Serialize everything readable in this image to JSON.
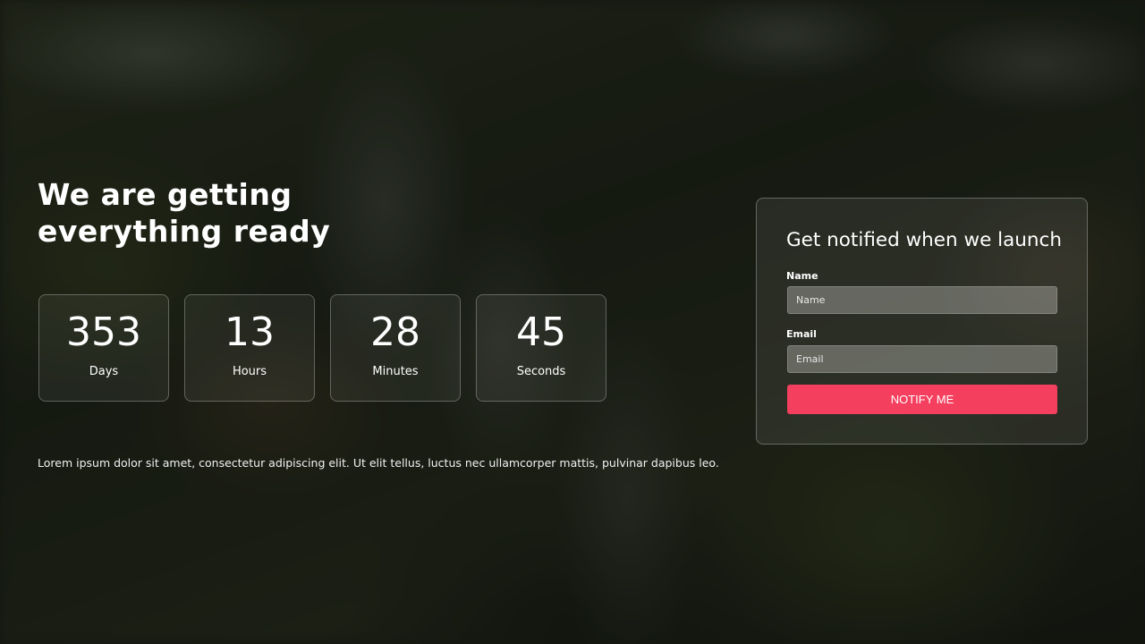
{
  "hero": {
    "headline_line1": "We are getting",
    "headline_line2": "everything ready",
    "description": "Lorem ipsum dolor sit amet, consectetur adipiscing elit. Ut elit tellus, luctus nec ullamcorper mattis, pulvinar dapibus leo."
  },
  "countdown": [
    {
      "value": "353",
      "label": "Days"
    },
    {
      "value": "13",
      "label": "Hours"
    },
    {
      "value": "28",
      "label": "Minutes"
    },
    {
      "value": "45",
      "label": "Seconds"
    }
  ],
  "signup": {
    "title": "Get notified when we launch",
    "name_label": "Name",
    "name_placeholder": "Name",
    "email_label": "Email",
    "email_placeholder": "Email",
    "button_label": "NOTIFY ME"
  },
  "colors": {
    "accent": "#f43f5e",
    "text": "#ffffff"
  }
}
